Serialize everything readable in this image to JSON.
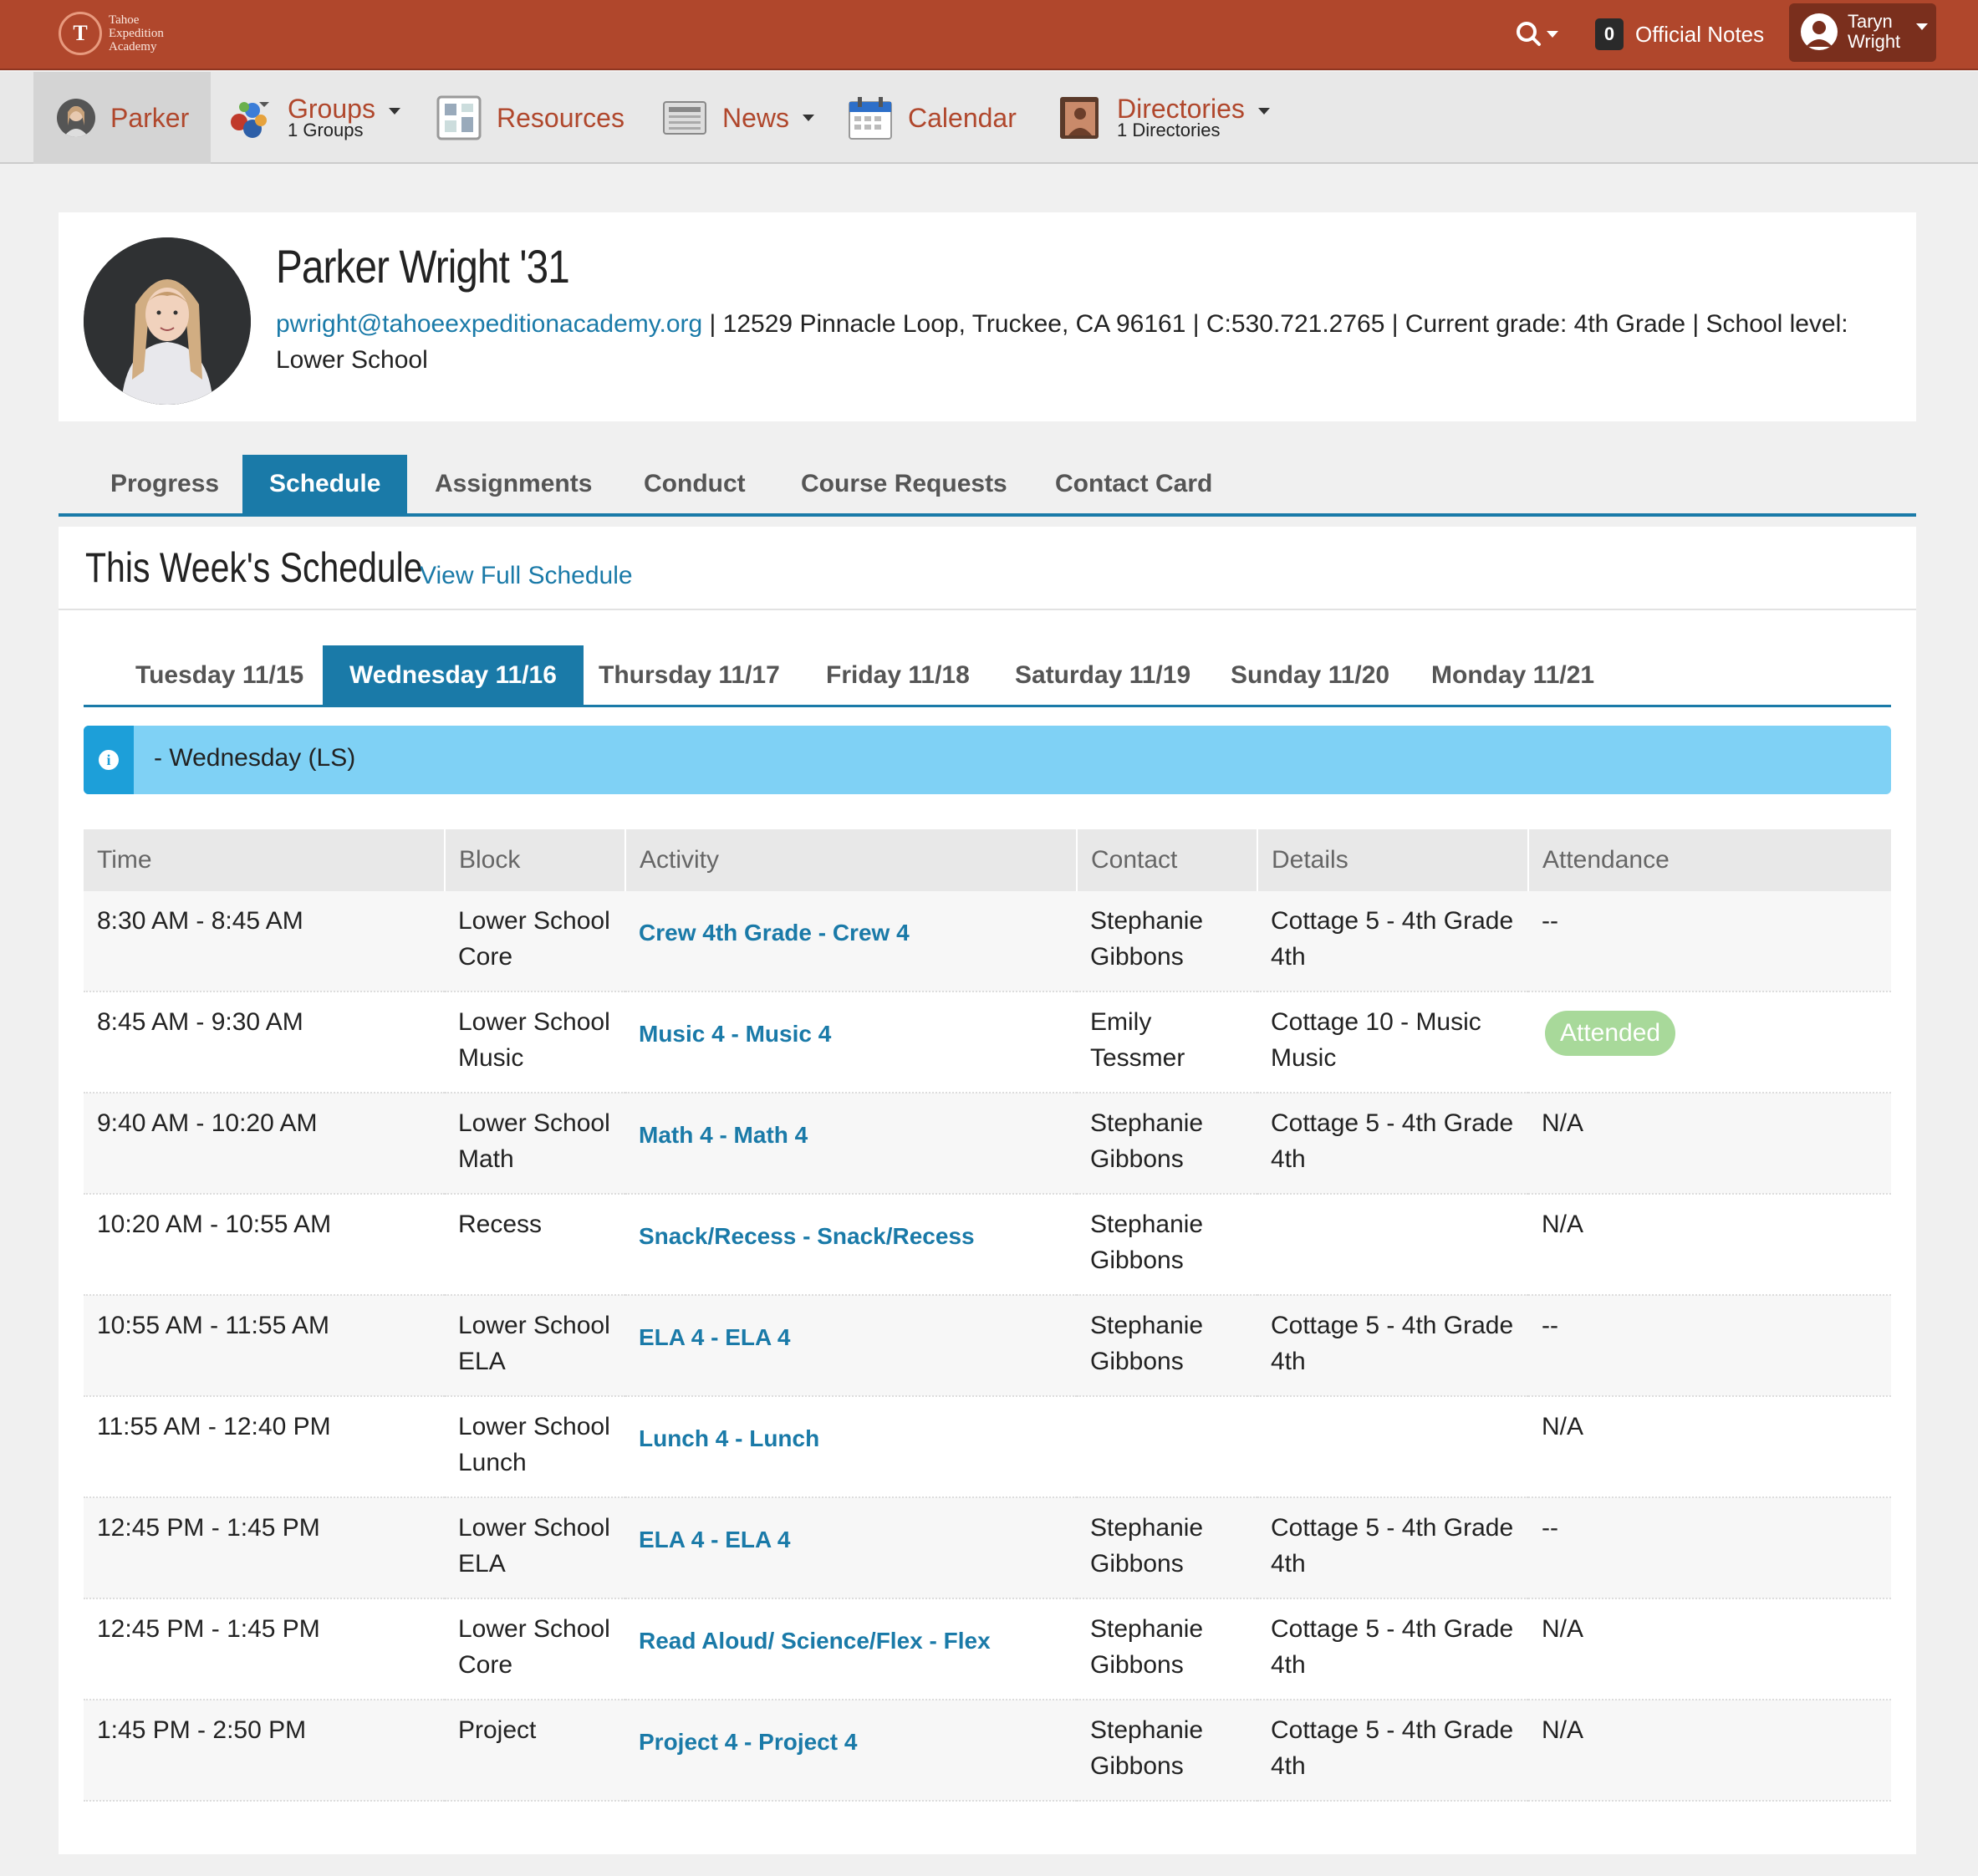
{
  "header": {
    "school_name_lines": [
      "Tahoe",
      "Expedition",
      "Academy"
    ],
    "logo_letter": "T",
    "notes_count": "0",
    "notes_label": "Official Notes",
    "user_first": "Taryn",
    "user_last": "Wright",
    "brand_color": "#b0472c"
  },
  "nav": {
    "student": "Parker",
    "groups": {
      "label": "Groups",
      "sub": "1 Groups"
    },
    "resources": "Resources",
    "news": "News",
    "calendar": "Calendar",
    "directories": {
      "label": "Directories",
      "sub": "1 Directories"
    }
  },
  "profile": {
    "name": "Parker Wright '31",
    "email": "pwright@tahoeexpeditionacademy.org",
    "details": " | 12529 Pinnacle Loop, Truckee, CA 96161 | C:530.721.2765 | Current grade: 4th Grade | School level: Lower School"
  },
  "tabs": [
    "Progress",
    "Schedule",
    "Assignments",
    "Conduct",
    "Course Requests",
    "Contact Card"
  ],
  "schedule": {
    "title": "This Week's Schedule",
    "full_link": "View Full Schedule",
    "days": [
      "Tuesday 11/15",
      "Wednesday 11/16",
      "Thursday 11/17",
      "Friday 11/18",
      "Saturday 11/19",
      "Sunday 11/20",
      "Monday 11/21"
    ],
    "alert": "- Wednesday (LS)",
    "columns": [
      "Time",
      "Block",
      "Activity",
      "Contact",
      "Details",
      "Attendance"
    ],
    "rows": [
      {
        "time": "8:30 AM - 8:45 AM",
        "block": "Lower School Core",
        "activity": "Crew 4th Grade - Crew 4",
        "contact": "Stephanie Gibbons",
        "details": "Cottage 5 - 4th Grade 4th",
        "attendance": "--"
      },
      {
        "time": "8:45 AM - 9:30 AM",
        "block": "Lower School Music",
        "activity": "Music 4 - Music 4",
        "contact": "Emily Tessmer",
        "details": "Cottage 10 - Music Music",
        "attendance": "Attended"
      },
      {
        "time": "9:40 AM - 10:20 AM",
        "block": "Lower School Math",
        "activity": "Math 4 - Math 4",
        "contact": "Stephanie Gibbons",
        "details": "Cottage 5 - 4th Grade 4th",
        "attendance": "N/A"
      },
      {
        "time": "10:20 AM - 10:55 AM",
        "block": "Recess",
        "activity": "Snack/Recess - Snack/Recess",
        "contact": "Stephanie Gibbons",
        "details": "",
        "attendance": "N/A"
      },
      {
        "time": "10:55 AM - 11:55 AM",
        "block": "Lower School ELA",
        "activity": "ELA 4 - ELA 4",
        "contact": "Stephanie Gibbons",
        "details": "Cottage 5 - 4th Grade 4th",
        "attendance": "--"
      },
      {
        "time": "11:55 AM - 12:40 PM",
        "block": "Lower School Lunch",
        "activity": "Lunch 4 - Lunch",
        "contact": "",
        "details": "",
        "attendance": "N/A"
      },
      {
        "time": "12:45 PM - 1:45 PM",
        "block": "Lower School ELA",
        "activity": "ELA 4 - ELA 4",
        "contact": "Stephanie Gibbons",
        "details": "Cottage 5 - 4th Grade 4th",
        "attendance": "--"
      },
      {
        "time": "12:45 PM - 1:45 PM",
        "block": "Lower School Core",
        "activity": "Read Aloud/ Science/Flex - Flex",
        "contact": "Stephanie Gibbons",
        "details": "Cottage 5 - 4th Grade 4th",
        "attendance": "N/A"
      },
      {
        "time": "1:45 PM - 2:50 PM",
        "block": "Project",
        "activity": "Project 4 - Project 4",
        "contact": "Stephanie Gibbons",
        "details": "Cottage 5 - 4th Grade 4th",
        "attendance": "N/A"
      }
    ]
  }
}
